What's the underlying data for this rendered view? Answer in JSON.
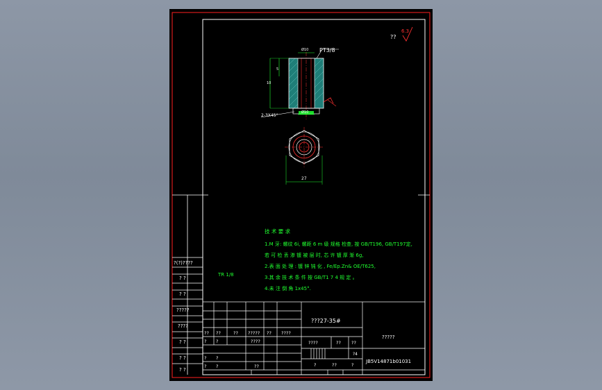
{
  "roughness": {
    "qmarks": "??",
    "value": "6.3"
  },
  "part_drawing": {
    "thread_label": "PT3/8",
    "dim_top": "Ø10",
    "dim_bottom": "Ø10",
    "dim_left_small": "5",
    "dim_left_large": "10",
    "chamfer_label": "2-3X45°",
    "width_dim": "27"
  },
  "ratio_label": "TR 1/8",
  "tech_requirements": {
    "title": "技 术 要 求",
    "lines": [
      "1.M 牙: 螺纹 6i, 螺距 6 m 级 规格 检查, 按 GB/T196, GB/T197定,",
      "若 可 检 丢 渗 镀 被 层 时, 芯 许 镀 厚 渐 6g,",
      "2.表 面 处 理 : 镀 锌 钝 化 , Fe/Ep.Zn& OE/T625,",
      "3.其 余 技 术 条 件 按 GB/T1 7 4 规 定 。",
      "4.未 注 倒 角 1x45°."
    ]
  },
  "left_strip": [
    "?(?)????",
    "?  ?",
    "?  ?",
    "?????",
    "????",
    "?  ?",
    "?  ?",
    "?  ?"
  ],
  "title_block": {
    "material": "???27-35#",
    "company": "?????",
    "drawing_no": "JB5V14871b01031",
    "row_a": [
      "??",
      "??",
      "??",
      "?????",
      "??",
      "????"
    ],
    "row_b": [
      "?",
      "?",
      "????",
      "????",
      "??",
      "??"
    ],
    "scale_label": "?4",
    "row_c": [
      "?",
      "?"
    ],
    "row_d": [
      "?",
      "?",
      "??",
      "?",
      "??",
      "?"
    ]
  },
  "colors": {
    "border": "#ff2020",
    "frame": "#ffffff",
    "text_green": "#20ff30",
    "part_cyan": "#2aa8a0"
  }
}
